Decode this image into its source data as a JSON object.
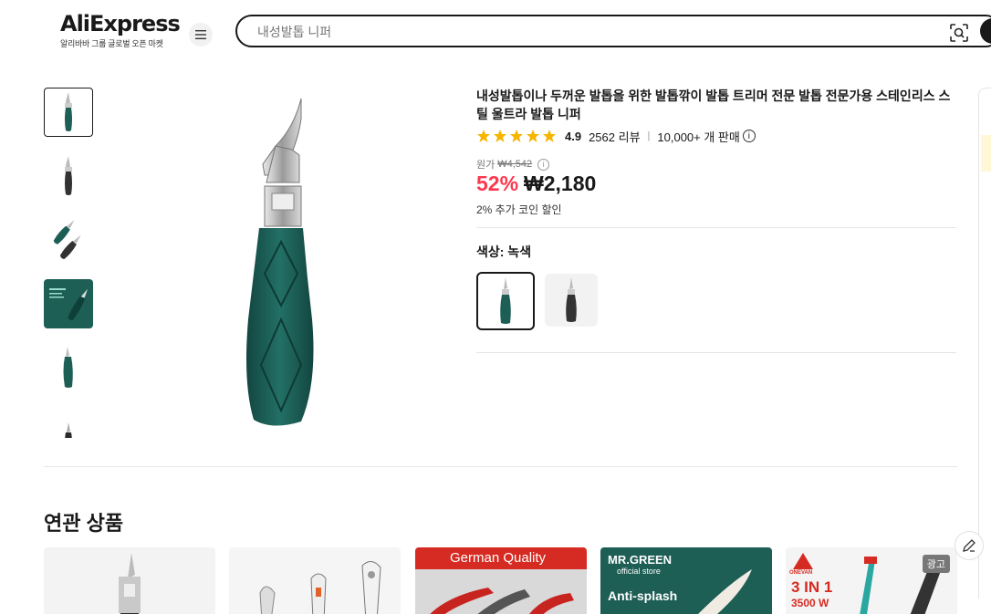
{
  "header": {
    "logo_text": "AliExpress",
    "logo_sub": "알리바바 그룹 글로벌 오픈 마켓",
    "search_placeholder": "내성발톱 니퍼"
  },
  "product": {
    "title": "내성발톱이나 두꺼운 발톱을 위한 발톱깎이 발톱 트리머 전문 발톱 전문가용 스테인리스 스틸 울트라 발톱 니퍼",
    "rating": "4.9",
    "reviews": "2562 리뷰",
    "sold": "10,000+ 개 판매",
    "original_label": "원가",
    "original_price": "₩4,542",
    "discount": "52%",
    "price": "₩2,180",
    "coin_text": "2% 추가 코인 할인",
    "color_label": "색상: 녹색",
    "stars": 5
  },
  "related": {
    "title": "연관 상품",
    "cards": [
      {
        "text": ""
      },
      {
        "text": ""
      },
      {
        "text": "German Quality"
      },
      {
        "text": "MR.GREEN",
        "sub": "official store",
        "sub2": "Anti-splash"
      },
      {
        "text": "3 IN 1",
        "sub": "3500 W",
        "brand": "ONEVAN",
        "badge": "광고"
      }
    ]
  },
  "colors": {
    "green": "#1d5e55",
    "dark": "#3a3a3a",
    "accent_red": "#fd384f"
  }
}
